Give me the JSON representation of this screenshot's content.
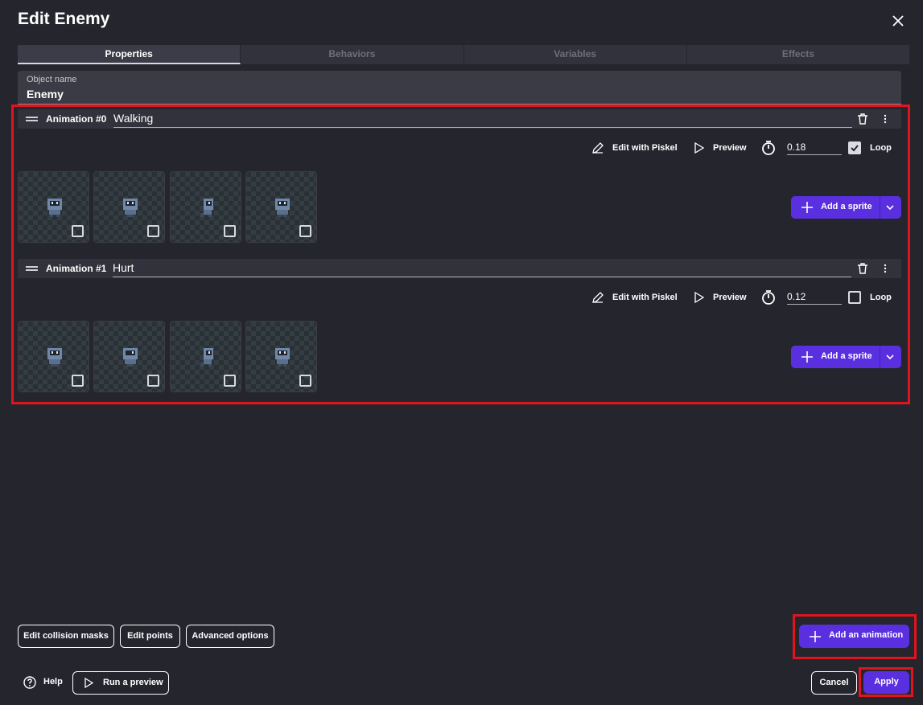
{
  "dialog": {
    "title": "Edit Enemy"
  },
  "tabs": [
    {
      "label": "Properties",
      "active": true
    },
    {
      "label": "Behaviors",
      "active": false
    },
    {
      "label": "Variables",
      "active": false
    },
    {
      "label": "Effects",
      "active": false
    }
  ],
  "object_name": {
    "label": "Object name",
    "value": "Enemy"
  },
  "animations": [
    {
      "label": "Animation #0",
      "name": "Walking",
      "edit_label": "Edit with Piskel",
      "preview_label": "Preview",
      "timer_value": "0.18",
      "loop_label": "Loop",
      "loop_checked": true,
      "add_sprite_label": "Add a sprite"
    },
    {
      "label": "Animation #1",
      "name": "Hurt",
      "edit_label": "Edit with Piskel",
      "preview_label": "Preview",
      "timer_value": "0.12",
      "loop_label": "Loop",
      "loop_checked": false,
      "add_sprite_label": "Add a sprite"
    }
  ],
  "footer": {
    "edit_collision_masks": "Edit collision masks",
    "edit_points": "Edit points",
    "advanced_options": "Advanced options",
    "add_animation": "Add an animation",
    "help": "Help",
    "run_preview": "Run a preview",
    "cancel": "Cancel",
    "apply": "Apply"
  },
  "colors": {
    "background": "#25252e",
    "accent": "#5a2fe0",
    "highlight": "#e0141e"
  }
}
